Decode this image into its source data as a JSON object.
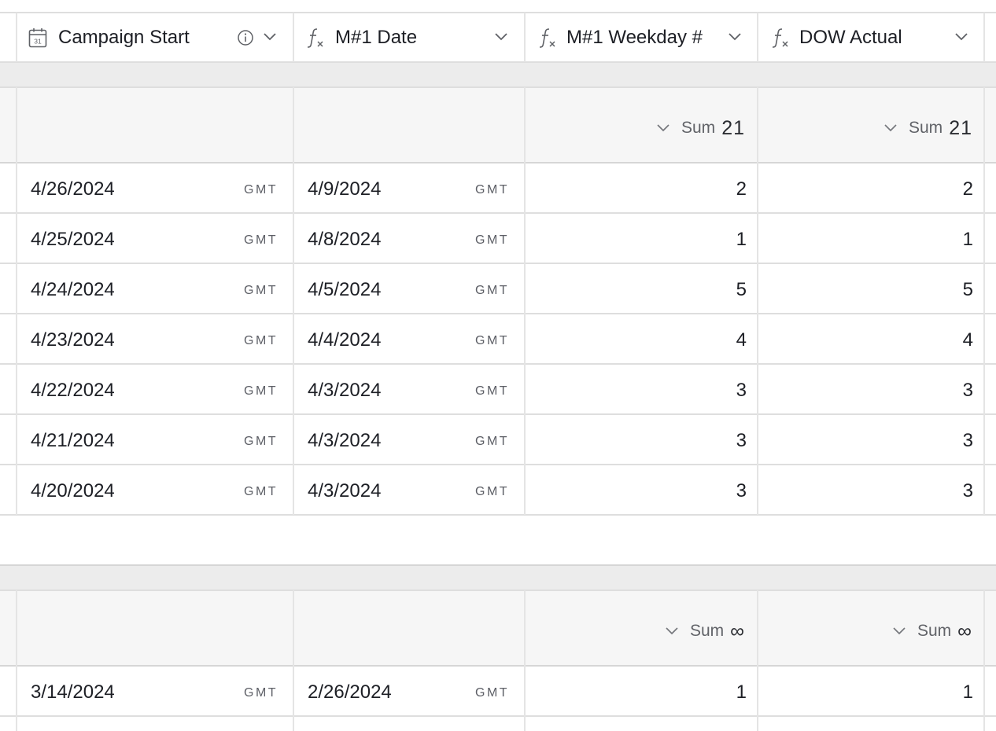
{
  "columns": [
    {
      "name": "Campaign Start",
      "type_icon": "calendar-icon",
      "info_icon": "info-icon",
      "menu_icon": "chevron-down-icon"
    },
    {
      "name": "M#1 Date",
      "type_icon": "formula-icon",
      "menu_icon": "chevron-down-icon"
    },
    {
      "name": "M#1 Weekday #",
      "type_icon": "formula-icon",
      "menu_icon": "chevron-down-icon"
    },
    {
      "name": "DOW Actual",
      "type_icon": "formula-icon",
      "menu_icon": "chevron-down-icon"
    }
  ],
  "groups": [
    {
      "summary": {
        "weekday_label": "Sum",
        "weekday_value": "21",
        "dow_label": "Sum",
        "dow_value": "21"
      },
      "rows": [
        {
          "campaign_start": "4/26/2024",
          "campaign_tz": "GMT",
          "m1_date": "4/9/2024",
          "m1_tz": "GMT",
          "weekday": "2",
          "dow": "2"
        },
        {
          "campaign_start": "4/25/2024",
          "campaign_tz": "GMT",
          "m1_date": "4/8/2024",
          "m1_tz": "GMT",
          "weekday": "1",
          "dow": "1"
        },
        {
          "campaign_start": "4/24/2024",
          "campaign_tz": "GMT",
          "m1_date": "4/5/2024",
          "m1_tz": "GMT",
          "weekday": "5",
          "dow": "5"
        },
        {
          "campaign_start": "4/23/2024",
          "campaign_tz": "GMT",
          "m1_date": "4/4/2024",
          "m1_tz": "GMT",
          "weekday": "4",
          "dow": "4"
        },
        {
          "campaign_start": "4/22/2024",
          "campaign_tz": "GMT",
          "m1_date": "4/3/2024",
          "m1_tz": "GMT",
          "weekday": "3",
          "dow": "3"
        },
        {
          "campaign_start": "4/21/2024",
          "campaign_tz": "GMT",
          "m1_date": "4/3/2024",
          "m1_tz": "GMT",
          "weekday": "3",
          "dow": "3"
        },
        {
          "campaign_start": "4/20/2024",
          "campaign_tz": "GMT",
          "m1_date": "4/3/2024",
          "m1_tz": "GMT",
          "weekday": "3",
          "dow": "3"
        }
      ]
    },
    {
      "summary": {
        "weekday_label": "Sum",
        "weekday_value": "∞",
        "dow_label": "Sum",
        "dow_value": "∞"
      },
      "rows": [
        {
          "campaign_start": "3/14/2024",
          "campaign_tz": "GMT",
          "m1_date": "2/26/2024",
          "m1_tz": "GMT",
          "weekday": "1",
          "dow": "1"
        }
      ]
    }
  ]
}
